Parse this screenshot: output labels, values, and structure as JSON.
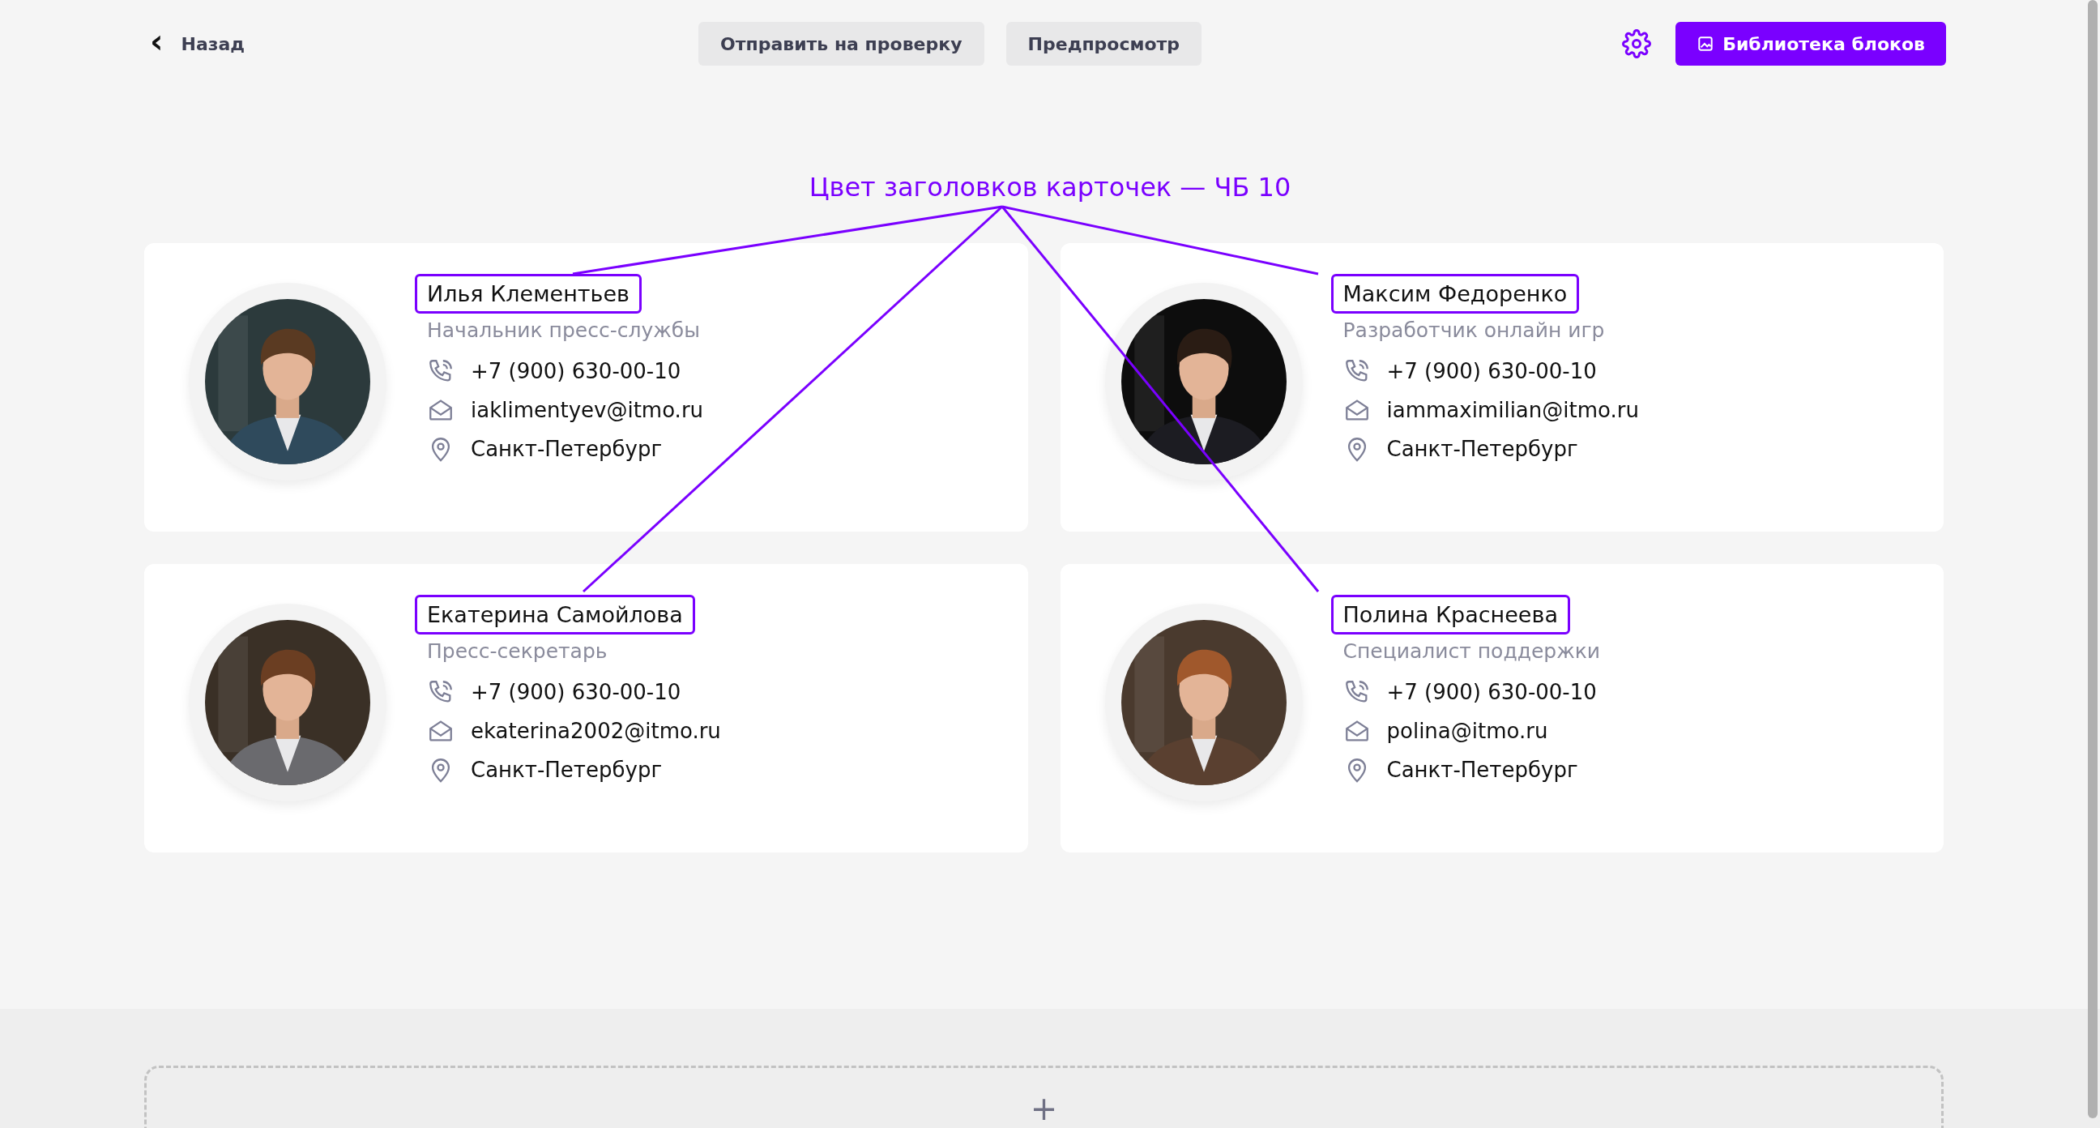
{
  "toolbar": {
    "back": {
      "icon": "‹",
      "label": "Назад"
    },
    "actions": [
      "Отправить на проверку",
      "Предпросмотр"
    ],
    "library_button": "Библиотека блоков"
  },
  "annotation": {
    "text": "Цвет заголовков карточек — ЧБ 10"
  },
  "cards": [
    {
      "name": "Илья Клементьев",
      "highlighted": true,
      "role": "Начальник пресс-службы",
      "phone": "+7 (900) 630-00-10",
      "email": "iaklimentyev@itmo.ru",
      "city": "Санкт-Петербург"
    },
    {
      "name": "Максим Федоренко",
      "highlighted": true,
      "role": "Разработчик онлайн игр",
      "phone": "+7 (900) 630-00-10",
      "email": "iammaximilian@itmo.ru",
      "city": "Санкт-Петербург"
    },
    {
      "name": "Екатерина Самойлова",
      "highlighted": true,
      "role": "Пресс-секретарь",
      "phone": "+7 (900) 630-00-10",
      "email": "ekaterina2002@itmo.ru",
      "city": "Санкт-Петербург"
    },
    {
      "name": "Полина Краснеева",
      "highlighted": true,
      "role": "Специалист поддержки",
      "phone": "+7 (900) 630-00-10",
      "email": "polina@itmo.ru",
      "city": "Санкт-Петербург"
    }
  ],
  "add_block": {
    "icon": "+"
  }
}
